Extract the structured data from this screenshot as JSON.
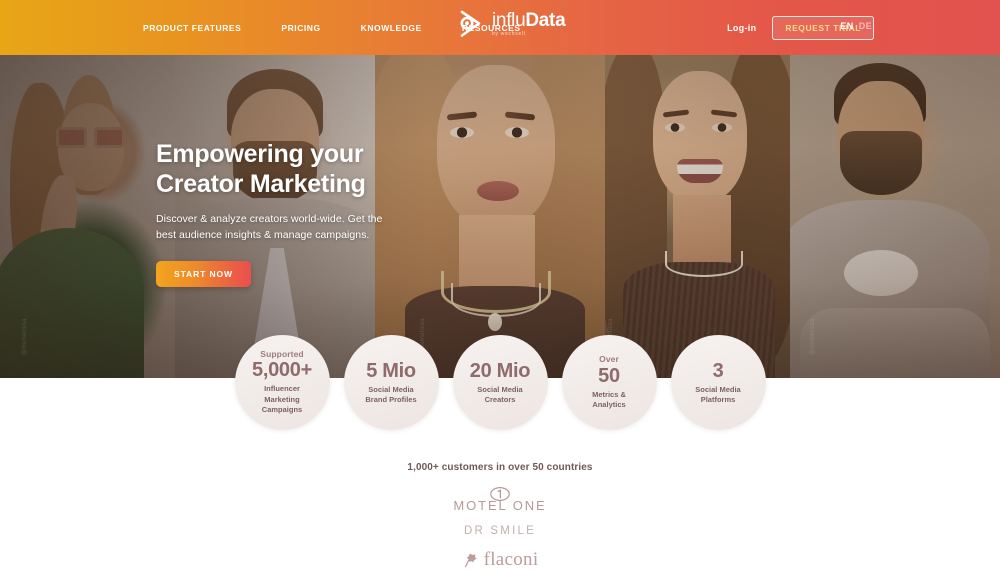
{
  "nav": {
    "links": [
      {
        "label": "PRODUCT FEATURES"
      },
      {
        "label": "PRICING"
      },
      {
        "label": "KNOWLEDGE"
      },
      {
        "label": "RESOURCES"
      }
    ],
    "logo": {
      "word_light": "influ",
      "word_bold": "Data",
      "tagline": "by wechselt",
      "icon": "infludata-pin-icon"
    },
    "login_label": "Log-in",
    "trial_label": "REQUEST TRIAL",
    "lang_active": "EN",
    "lang_inactive": "DE"
  },
  "hero": {
    "title_line1": "Empowering your",
    "title_line2": "Creator Marketing",
    "subtitle": "Discover & analyze creators world-wide. Get the best audience insights & manage campaigns.",
    "cta_label": "START NOW"
  },
  "stats": [
    {
      "pre": "Supported",
      "value": "5,000+",
      "label_line1": "Influencer",
      "label_line2": "Marketing",
      "label_line3": "Campaigns"
    },
    {
      "pre": "",
      "value": "5 Mio",
      "label_line1": "Social Media",
      "label_line2": "Brand Profiles",
      "label_line3": ""
    },
    {
      "pre": "",
      "value": "20 Mio",
      "label_line1": "Social Media",
      "label_line2": "Creators",
      "label_line3": ""
    },
    {
      "pre": "Over",
      "value": "50",
      "label_line1": "Metrics &",
      "label_line2": "Analytics",
      "label_line3": ""
    },
    {
      "pre": "",
      "value": "3",
      "label_line1": "Social Media",
      "label_line2": "Platforms",
      "label_line3": ""
    }
  ],
  "customers": {
    "title": "1,000+ customers in over 50 countries",
    "logos": [
      {
        "name": "Motel One",
        "text": "MOTEL ONE"
      },
      {
        "name": "Dr Smile",
        "text": "DR SMILE"
      },
      {
        "name": "flaconi",
        "text": "flaconi"
      }
    ]
  },
  "colors": {
    "header_gradient_start": "#E8A617",
    "header_gradient_end": "#E2524F",
    "cta_gradient_start": "#F2A51C",
    "cta_gradient_end": "#EA4F50",
    "stat_circle_bg": "#F2EDEB",
    "stat_text": "#8F6B6B",
    "trial_btn_text": "#FFD98A"
  }
}
